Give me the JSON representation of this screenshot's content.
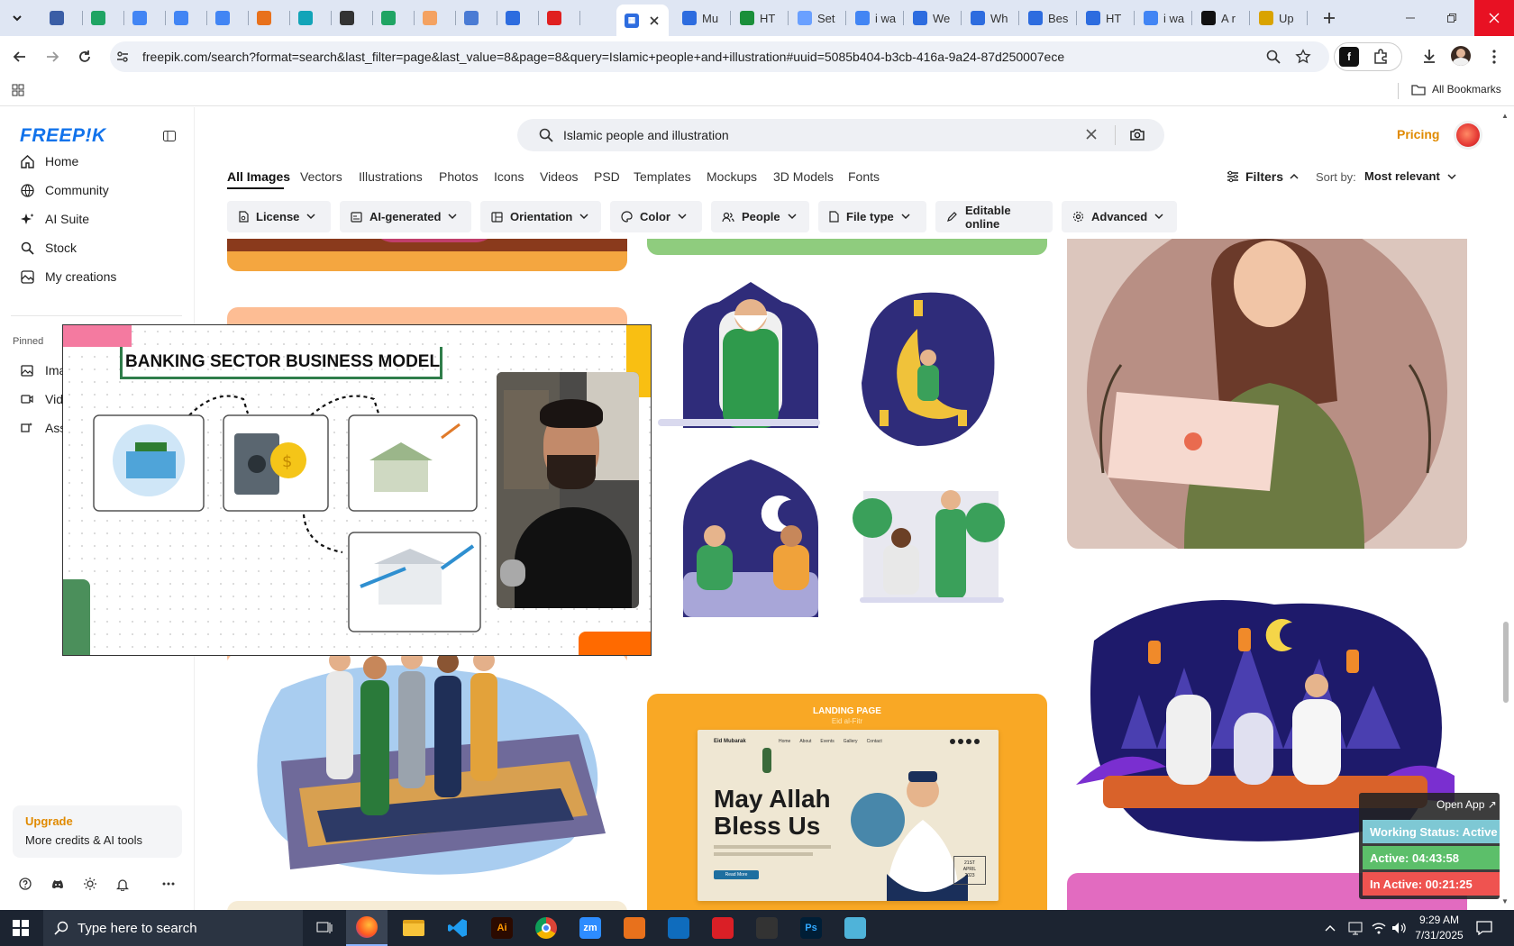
{
  "browser": {
    "tabs": [
      {
        "label": "",
        "color": "#3b5ea6"
      },
      {
        "label": "",
        "color": "#1fa463"
      },
      {
        "label": "",
        "color": "#4285f4"
      },
      {
        "label": "",
        "color": "#4285f4"
      },
      {
        "label": "",
        "color": "#4285f4"
      },
      {
        "label": "",
        "color": "#e8711c"
      },
      {
        "label": "",
        "color": "#12a4b8"
      },
      {
        "label": "",
        "color": "#333333"
      },
      {
        "label": "",
        "color": "#1fa463"
      },
      {
        "label": "",
        "color": "#f4a261"
      },
      {
        "label": "",
        "color": "#4a7bd4"
      },
      {
        "label": "",
        "color": "#2d6cdf"
      },
      {
        "label": "",
        "color": "#e02020"
      },
      {
        "label": "",
        "color": "#2d6cdf"
      }
    ],
    "active_tab_color": "#2d6cdf",
    "named_tabs": [
      {
        "label": "Mu",
        "color": "#2d6cdf"
      },
      {
        "label": "HT",
        "color": "#1a8f3a"
      },
      {
        "label": "Set",
        "color": "#6aa0ff"
      },
      {
        "label": "i wa",
        "color": "#4285f4"
      },
      {
        "label": "We",
        "color": "#2d6cdf"
      },
      {
        "label": "Wh",
        "color": "#2d6cdf"
      },
      {
        "label": "Bes",
        "color": "#2d6cdf"
      },
      {
        "label": "HT",
        "color": "#2d6cdf"
      },
      {
        "label": "i wa",
        "color": "#4285f4"
      },
      {
        "label": "A r",
        "color": "#111111"
      },
      {
        "label": "Up",
        "color": "#d9a300"
      }
    ],
    "url": "freepik.com/search?format=search&last_filter=page&last_value=8&page=8&query=Islamic+people+and+illustration#uuid=5085b404-b3cb-416a-9a24-87d250007ece",
    "all_bookmarks": "All Bookmarks"
  },
  "sidebar": {
    "logo": "FREEP!K",
    "items": [
      {
        "label": "Home",
        "icon": "home-icon"
      },
      {
        "label": "Community",
        "icon": "globe-icon"
      },
      {
        "label": "AI Suite",
        "icon": "sparkle-icon"
      },
      {
        "label": "Stock",
        "icon": "search-icon"
      },
      {
        "label": "My creations",
        "icon": "creations-icon"
      }
    ],
    "pinned_heading": "Pinned",
    "pinned": [
      {
        "label": "Ima",
        "icon": "image-icon"
      },
      {
        "label": "Vide",
        "icon": "video-icon"
      },
      {
        "label": "Ass",
        "icon": "assistant-icon"
      }
    ],
    "upgrade_title": "Upgrade",
    "upgrade_sub": "More credits & AI tools"
  },
  "search": {
    "query": "Islamic people and illustration",
    "pricing": "Pricing"
  },
  "categories": [
    "All Images",
    "Vectors",
    "Illustrations",
    "Photos",
    "Icons",
    "Videos",
    "PSD",
    "Templates",
    "Mockups",
    "3D Models",
    "Fonts"
  ],
  "filters_label": "Filters",
  "sort_label": "Sort by:",
  "sort_value": "Most relevant",
  "chips": [
    {
      "label": "License",
      "icon": "license-icon"
    },
    {
      "label": "AI-generated",
      "icon": "ai-icon"
    },
    {
      "label": "Orientation",
      "icon": "orientation-icon"
    },
    {
      "label": "Color",
      "icon": "palette-icon"
    },
    {
      "label": "People",
      "icon": "people-icon"
    },
    {
      "label": "File type",
      "icon": "file-icon"
    },
    {
      "label": "Editable online",
      "icon": "pen-icon"
    },
    {
      "label": "Advanced",
      "icon": "gear-icon"
    }
  ],
  "video": {
    "title": "BANKING SECTOR BUSINESS MODEL"
  },
  "landing": {
    "tag": "LANDING PAGE",
    "sub": "Eid al-Fitr",
    "brand": "Eid Mubarak",
    "nav": [
      "Home",
      "About",
      "Events",
      "Gallery",
      "Contact"
    ],
    "headline1": "May Allah",
    "headline2": "Bless Us",
    "button": "Read More",
    "date1": "21ST",
    "date2": "APRIL",
    "date3": "2023"
  },
  "status": {
    "open_app": "Open App ↗",
    "working": "Working Status: Active",
    "active": "Active: 04:43:58",
    "inactive": "In Active: 00:21:25"
  },
  "taskbar": {
    "search_placeholder": "Type here to search",
    "time": "9:29 AM",
    "date": "7/31/2025",
    "apps": [
      {
        "label": "Ai",
        "color": "#2b0a00",
        "fg": "#ff9a00"
      },
      {
        "label": "",
        "color": "#dddddd",
        "fg": "#333"
      },
      {
        "label": "zm",
        "color": "#2d8cff",
        "fg": "#fff"
      },
      {
        "label": "",
        "color": "#e8711c",
        "fg": "#fff"
      },
      {
        "label": "",
        "color": "#0f6cbd",
        "fg": "#fff"
      },
      {
        "label": "",
        "color": "#da1f26",
        "fg": "#fff"
      },
      {
        "label": "",
        "color": "#333333",
        "fg": "#fff"
      },
      {
        "label": "Ps",
        "color": "#001e36",
        "fg": "#31a8ff"
      },
      {
        "label": "",
        "color": "#4fb3d9",
        "fg": "#fff"
      }
    ]
  }
}
